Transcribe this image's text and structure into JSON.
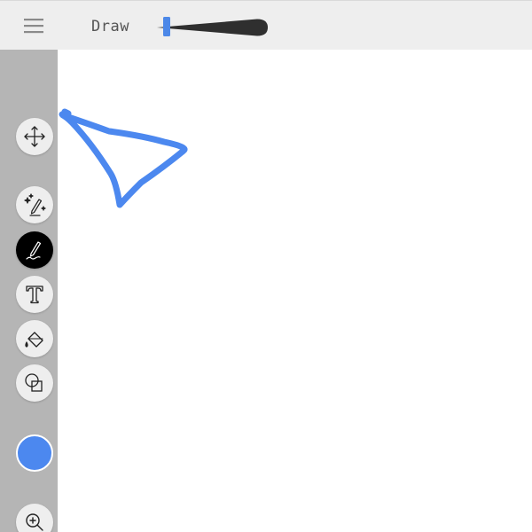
{
  "header": {
    "mode_label": "Draw",
    "menu_icon": "hamburger-menu-icon"
  },
  "brush_size_slider": {
    "value_fraction": 0.08,
    "handle_color": "#4c88e8",
    "track_color": "#2f2f2f"
  },
  "toolbar": {
    "tools": [
      {
        "id": "move",
        "icon": "move-arrows-icon",
        "active": false
      },
      {
        "id": "magic-pen",
        "icon": "magic-pen-icon",
        "active": false
      },
      {
        "id": "pen",
        "icon": "pen-icon",
        "active": true
      },
      {
        "id": "text",
        "icon": "text-icon",
        "active": false
      },
      {
        "id": "fill",
        "icon": "paint-bucket-icon",
        "active": false
      },
      {
        "id": "shapes",
        "icon": "shapes-icon",
        "active": false
      },
      {
        "id": "zoom",
        "icon": "zoom-in-icon",
        "active": false
      }
    ],
    "current_color": "#4c88ef"
  },
  "canvas": {
    "background": "#ffffff",
    "stroke_color": "#4c88ef"
  }
}
